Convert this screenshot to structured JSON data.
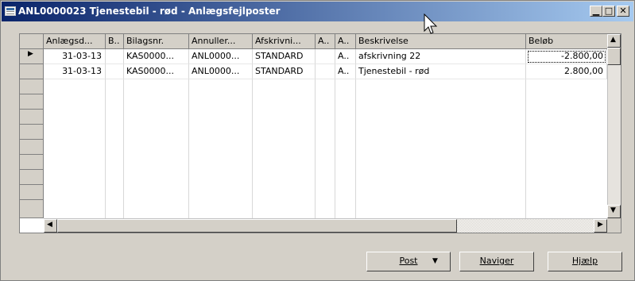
{
  "window": {
    "title": "ANL0000023 Tjenestebil - rød - Anlægsfejlposter",
    "controls": {
      "minimize": "▁",
      "maximize": "□",
      "close": "✕"
    }
  },
  "table": {
    "columns": [
      "Anlægsd...",
      "B..",
      "Bilagsnr.",
      "Annuller...",
      "Afskrivni...",
      "A..",
      "A..",
      "Beskrivelse",
      "Beløb"
    ],
    "rows": [
      {
        "current": true,
        "cells": [
          "31-03-13",
          "",
          "KAS0000...",
          "ANL0000...",
          "STANDARD",
          "",
          "A..",
          "afskrivning 22",
          "-2.800,00"
        ]
      },
      {
        "current": false,
        "cells": [
          "31-03-13",
          "",
          "KAS0000...",
          "ANL0000...",
          "STANDARD",
          "",
          "A..",
          "Tjenestebil - rød",
          "2.800,00"
        ]
      }
    ],
    "row_marker": "▶"
  },
  "buttons": {
    "post": "Post",
    "post_arrow": "▼",
    "navigate": "Naviger",
    "help": "Hjælp"
  },
  "scroll_icons": {
    "up": "▲",
    "down": "▼",
    "left": "◀",
    "right": "▶"
  }
}
